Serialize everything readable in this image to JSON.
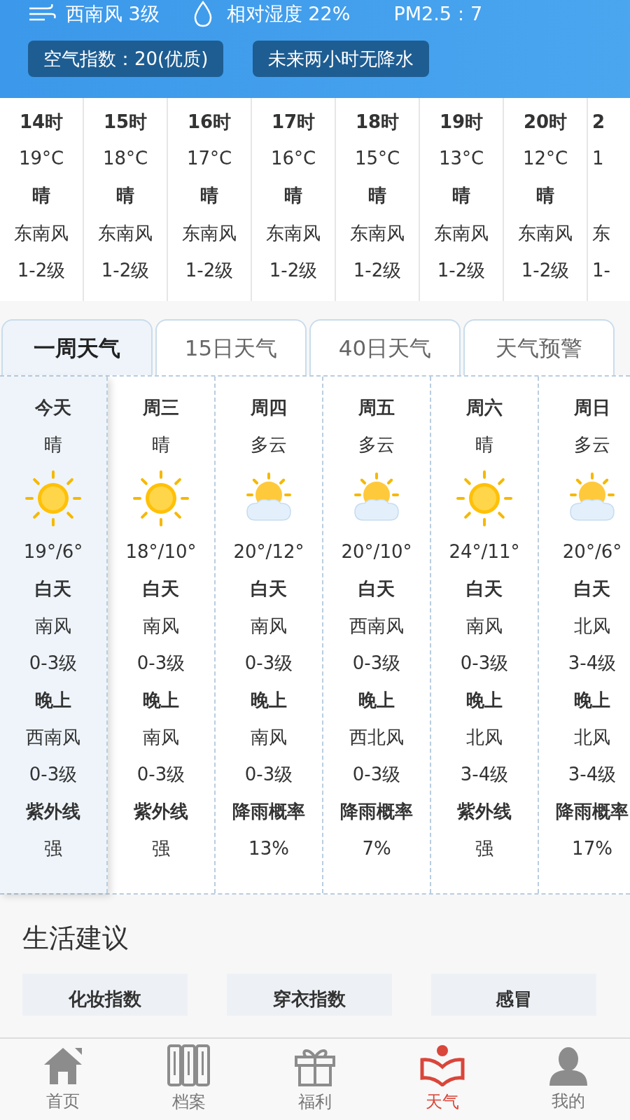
{
  "header": {
    "wind": "西南风 3级",
    "humidity": "相对湿度 22%",
    "pm25": "PM2.5：7",
    "chips": [
      "空气指数：20(优质)",
      "未来两小时无降水"
    ]
  },
  "hourly": [
    {
      "hour": "14时",
      "temp": "19°C",
      "weather": "晴",
      "wind": "东南风",
      "level": "1-2级"
    },
    {
      "hour": "15时",
      "temp": "18°C",
      "weather": "晴",
      "wind": "东南风",
      "level": "1-2级"
    },
    {
      "hour": "16时",
      "temp": "17°C",
      "weather": "晴",
      "wind": "东南风",
      "level": "1-2级"
    },
    {
      "hour": "17时",
      "temp": "16°C",
      "weather": "晴",
      "wind": "东南风",
      "level": "1-2级"
    },
    {
      "hour": "18时",
      "temp": "15°C",
      "weather": "晴",
      "wind": "东南风",
      "level": "1-2级"
    },
    {
      "hour": "19时",
      "temp": "13°C",
      "weather": "晴",
      "wind": "东南风",
      "level": "1-2级"
    },
    {
      "hour": "20时",
      "temp": "12°C",
      "weather": "晴",
      "wind": "东南风",
      "level": "1-2级"
    },
    {
      "hour": "2",
      "temp": "1",
      "wind": "东",
      "level": "1-"
    }
  ],
  "tabs": [
    {
      "label": "一周天气",
      "selected": true
    },
    {
      "label": "15日天气",
      "selected": false
    },
    {
      "label": "40日天气",
      "selected": false
    },
    {
      "label": "天气预警",
      "selected": false
    }
  ],
  "days": [
    {
      "name": "今天",
      "weather": "晴",
      "kind": "sunny",
      "temp": "19°/6°",
      "day_label": "白天",
      "day_wind": "南风",
      "day_level": "0-3级",
      "night_label": "晚上",
      "night_wind": "西南风",
      "night_level": "0-3级",
      "extra_label": "紫外线",
      "extra_value": "强",
      "selected": true
    },
    {
      "name": "周三",
      "weather": "晴",
      "kind": "sunny",
      "temp": "18°/10°",
      "day_label": "白天",
      "day_wind": "南风",
      "day_level": "0-3级",
      "night_label": "晚上",
      "night_wind": "南风",
      "night_level": "0-3级",
      "extra_label": "紫外线",
      "extra_value": "强",
      "selected": false
    },
    {
      "name": "周四",
      "weather": "多云",
      "kind": "cloudy",
      "temp": "20°/12°",
      "day_label": "白天",
      "day_wind": "南风",
      "day_level": "0-3级",
      "night_label": "晚上",
      "night_wind": "南风",
      "night_level": "0-3级",
      "extra_label": "降雨概率",
      "extra_value": "13%",
      "selected": false
    },
    {
      "name": "周五",
      "weather": "多云",
      "kind": "cloudy",
      "temp": "20°/10°",
      "day_label": "白天",
      "day_wind": "西南风",
      "day_level": "0-3级",
      "night_label": "晚上",
      "night_wind": "西北风",
      "night_level": "0-3级",
      "extra_label": "降雨概率",
      "extra_value": "7%",
      "selected": false
    },
    {
      "name": "周六",
      "weather": "晴",
      "kind": "sunny",
      "temp": "24°/11°",
      "day_label": "白天",
      "day_wind": "南风",
      "day_level": "0-3级",
      "night_label": "晚上",
      "night_wind": "北风",
      "night_level": "3-4级",
      "extra_label": "紫外线",
      "extra_value": "强",
      "selected": false
    },
    {
      "name": "周日",
      "weather": "多云",
      "kind": "cloudy",
      "temp": "20°/6°",
      "day_label": "白天",
      "day_wind": "北风",
      "day_level": "3-4级",
      "night_label": "晚上",
      "night_wind": "北风",
      "night_level": "3-4级",
      "extra_label": "降雨概率",
      "extra_value": "17%",
      "selected": false
    }
  ],
  "life": {
    "title": "生活建议",
    "cards": [
      "化妆指数",
      "穿衣指数",
      "感冒"
    ]
  },
  "nav": [
    {
      "label": "首页",
      "kind": "home",
      "selected": false
    },
    {
      "label": "档案",
      "kind": "files",
      "selected": false
    },
    {
      "label": "福利",
      "kind": "gift",
      "selected": false
    },
    {
      "label": "天气",
      "kind": "weather",
      "selected": true
    },
    {
      "label": "我的",
      "kind": "user",
      "selected": false
    }
  ]
}
